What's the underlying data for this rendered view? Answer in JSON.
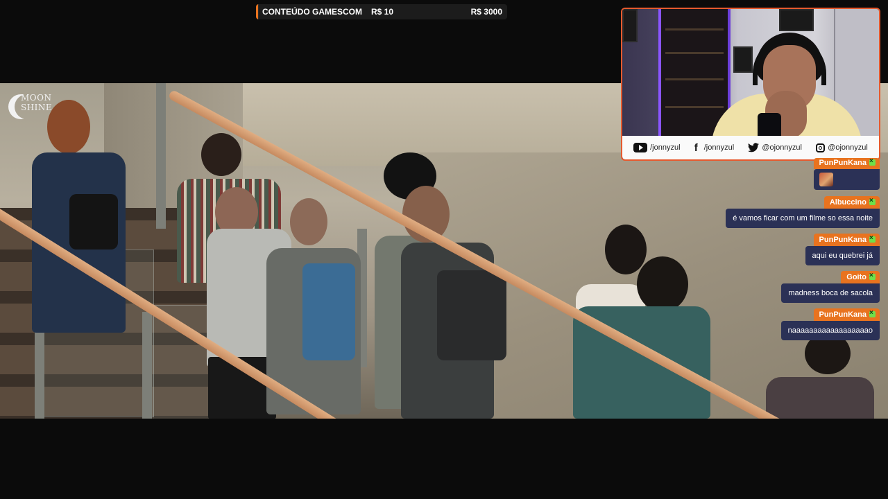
{
  "goal": {
    "title": "CONTEÚDO GAMESCOM",
    "current": "R$ 10",
    "target": "R$ 3000",
    "progress": 0.0033,
    "accent": "#e8731f"
  },
  "video": {
    "logo_text_line1": "MOON",
    "logo_text_line2": "SHINE"
  },
  "webcam": {
    "border_color": "#e65a2e",
    "socials": [
      {
        "icon": "youtube-icon",
        "handle": "/jonnyzul"
      },
      {
        "icon": "facebook-icon",
        "handle": "/jonnyzul"
      },
      {
        "icon": "twitter-icon",
        "handle": "@ojonnyzul"
      },
      {
        "icon": "instagram-icon",
        "handle": "@ojonnyzul"
      }
    ]
  },
  "chat": {
    "username_color": "#e8731f",
    "bubble_color": "#2b3156",
    "messages": [
      {
        "user": "PunPunKana",
        "text": "",
        "emote": "face-emote"
      },
      {
        "user": "Albuccino",
        "text": "é vamos ficar com um filme so essa noite"
      },
      {
        "user": "PunPunKana",
        "text": "aqui eu quebrei já"
      },
      {
        "user": "Goito",
        "text": "madness boca de sacola"
      },
      {
        "user": "PunPunKana",
        "text": "naaaaaaaaaaaaaaaaaao"
      }
    ]
  }
}
